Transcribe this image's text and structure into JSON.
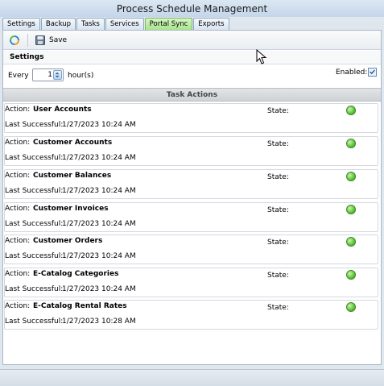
{
  "window": {
    "title": "Process Schedule Management"
  },
  "tabs": [
    {
      "label": "Settings",
      "active": false
    },
    {
      "label": "Backup",
      "active": false
    },
    {
      "label": "Tasks",
      "active": false
    },
    {
      "label": "Services",
      "active": false
    },
    {
      "label": "Portal Sync",
      "active": true
    },
    {
      "label": "Exports",
      "active": false
    }
  ],
  "toolbar": {
    "refresh_icon": "refresh-icon",
    "save_icon": "disk-icon",
    "save_label": "Save"
  },
  "settings": {
    "title": "Settings",
    "every_label": "Every",
    "interval_value": "1",
    "unit_label": "hour(s)",
    "enabled_label": "Enabled:",
    "enabled": true
  },
  "task_actions": {
    "header": "Task Actions",
    "action_label": "Action:",
    "state_label": "State:",
    "last_successful_label": "Last Successful:",
    "items": [
      {
        "name": "User Accounts",
        "last_successful": "1/27/2023 10:24 AM",
        "state_color": "#5cc236"
      },
      {
        "name": "Customer Accounts",
        "last_successful": "1/27/2023 10:24 AM",
        "state_color": "#5cc236"
      },
      {
        "name": "Customer Balances",
        "last_successful": "1/27/2023 10:24 AM",
        "state_color": "#5cc236"
      },
      {
        "name": "Customer Invoices",
        "last_successful": "1/27/2023 10:24 AM",
        "state_color": "#5cc236"
      },
      {
        "name": "Customer Orders",
        "last_successful": "1/27/2023 10:24 AM",
        "state_color": "#5cc236"
      },
      {
        "name": "E-Catalog Categories",
        "last_successful": "1/27/2023 10:24 AM",
        "state_color": "#5cc236"
      },
      {
        "name": "E-Catalog Rental Rates",
        "last_successful": "1/27/2023 10:28 AM",
        "state_color": "#5cc236"
      }
    ]
  }
}
